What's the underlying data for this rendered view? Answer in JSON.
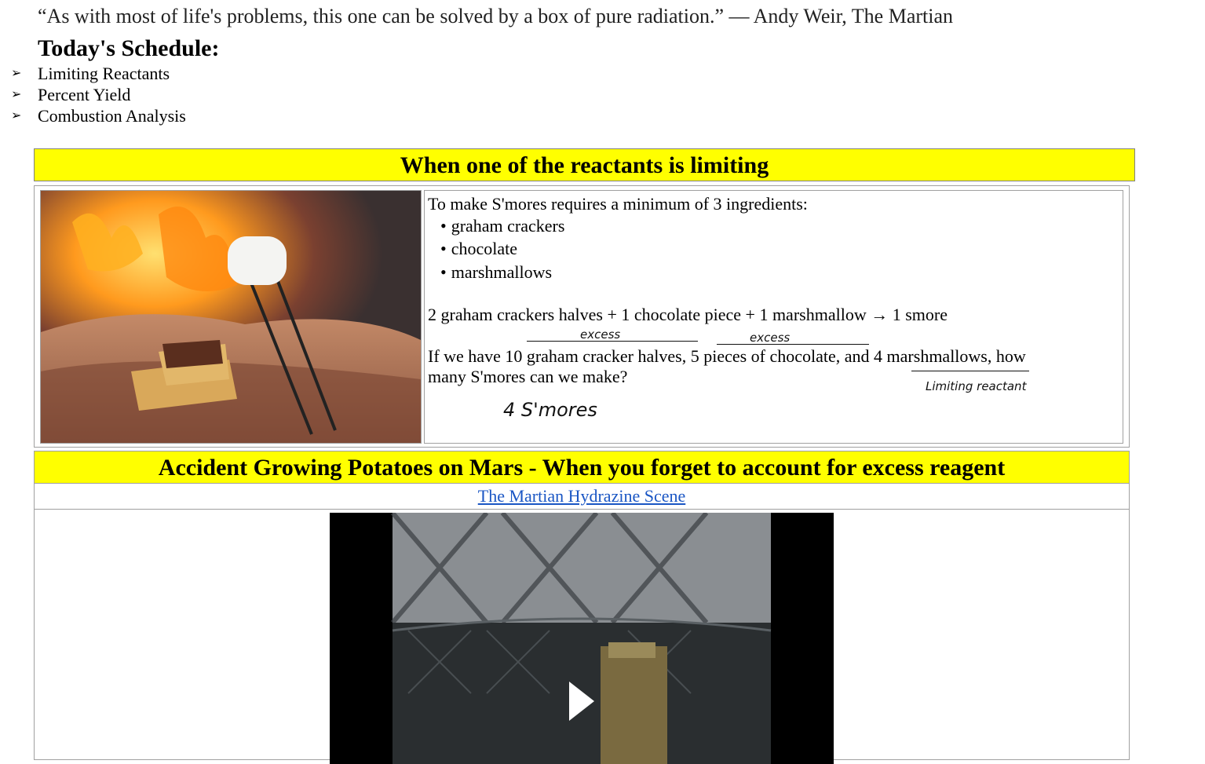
{
  "quote": "“As with most of life's problems, this one can be solved by a box of pure radiation.” — Andy Weir, The Martian",
  "schedule": {
    "title": "Today's Schedule:",
    "items": [
      "Limiting Reactants",
      "Percent Yield",
      "Combustion Analysis"
    ]
  },
  "section1": {
    "banner": "When one of the reactants is limiting",
    "intro": "To make S'mores requires a minimum of 3 ingredients:",
    "ingredients": [
      "graham crackers",
      "chocolate",
      "marshmallows"
    ],
    "equation": "2 graham crackers halves + 1 chocolate piece + 1 marshmallow → 1 smore",
    "question_line1": "If we have 10 graham cracker halves, 5 pieces of chocolate, and 4 marshmallows, how",
    "question_line2": "many S'mores can we make?",
    "annotations": {
      "excess1": "excess",
      "excess2": "excess",
      "limiting": "Limiting reactant",
      "answer": "4 S'mores"
    }
  },
  "section2": {
    "banner": "Accident Growing Potatoes on Mars - When you forget to account for excess reagent",
    "link_text": "The Martian Hydrazine Scene"
  },
  "colors": {
    "banner": "#ffff00",
    "link": "#1a56c4"
  }
}
